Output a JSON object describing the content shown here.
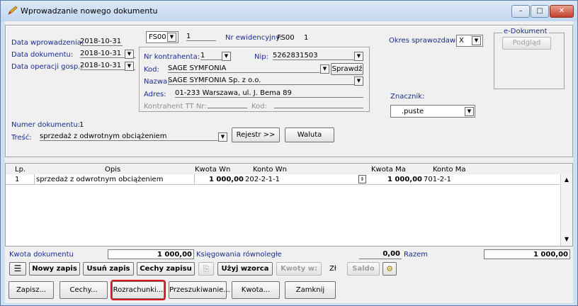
{
  "window": {
    "title": "Wprowadzanie nowego dokumentu",
    "min": "–",
    "max": "□",
    "close": "✕"
  },
  "header": {
    "data_wprowadzenia_label": "Data wprowadzenia:",
    "data_wprowadzenia": "2018-10-31",
    "data_dokumentu_label": "Data dokumentu:",
    "data_dokumentu": "2018-10-31",
    "data_operacji_label": "Data operacji gosp.:",
    "data_operacji": "2018-10-31",
    "typ_dok": "FS00",
    "nr_dok": "1",
    "nr_ewid_label": "Nr ewidencyjny:",
    "nr_ewid": "FS00",
    "nr_ewid_num": "1",
    "okres_label": "Okres sprawozdawczy:",
    "okres_value": "X",
    "edok_label": "e-Dokument",
    "podglad": "Podgląd",
    "znacznik_label": "Znacznik:",
    "znacznik_value": ".puste",
    "numer_dok_label": "Numer dokumentu:",
    "numer_dok": "1",
    "tresc_label": "Treść:",
    "tresc": "sprzedaż z odwrotnym obciążeniem",
    "rejestr": "Rejestr >>",
    "waluta": "Waluta"
  },
  "kontrahent": {
    "nr_label": "Nr kontrahenta:",
    "nr": "1",
    "nip_label": "Nip:",
    "nip": "5262831503",
    "kod_label": "Kod:",
    "kod": "SAGE SYMFONIA",
    "sprawdz": "Sprawdź",
    "nazwa_label": "Nazwa:",
    "nazwa": "SAGE SYMFONIA Sp. z o.o.",
    "adres_label": "Adres:",
    "adres": "01-233 Warszawa, ul. J. Bema 89",
    "tt_label": "Kontrahent TT Nr:",
    "tt_kod_label": "Kod:"
  },
  "table": {
    "columns": [
      "Lp.",
      "Opis",
      "Kwota Wn",
      "Konto Wn",
      "Kwota Ma",
      "Konto Ma"
    ],
    "rows": [
      {
        "lp": "1",
        "opis": "sprzedaż z odwrotnym obciążeniem",
        "kwota_wn": "1 000,00",
        "konto_wn": "202-2-1-1",
        "kwota_ma": "1 000,00",
        "konto_ma": "701-2-1"
      }
    ]
  },
  "summary": {
    "kwota_label": "Kwota dokumentu",
    "kwota": "1 000,00",
    "ksiegowania_label": "Księgowania równoległe",
    "ksiegowania": "0,00",
    "razem_label": "Razem",
    "razem": "1 000,00"
  },
  "toolbar": {
    "nowy": "Nowy zapis",
    "usun": "Usuń zapis",
    "cechy_zapisu": "Cechy zapisu",
    "uzyj": "Użyj wzorca",
    "kwoty": "Kwoty w:",
    "waluta": "Zł",
    "saldo": "Saldo"
  },
  "bottom": {
    "zapisz": "Zapisz...",
    "cechy": "Cechy...",
    "rozrachunki": "Rozrachunki...",
    "przeszukiwanie": "Przeszukiwanie...",
    "kwota": "Kwota...",
    "zamknij": "Zamknij"
  },
  "colors": {
    "label_blue": "#1a2b8c",
    "highlight_red": "#e0101a",
    "title_bg": "#cfe0f3"
  }
}
